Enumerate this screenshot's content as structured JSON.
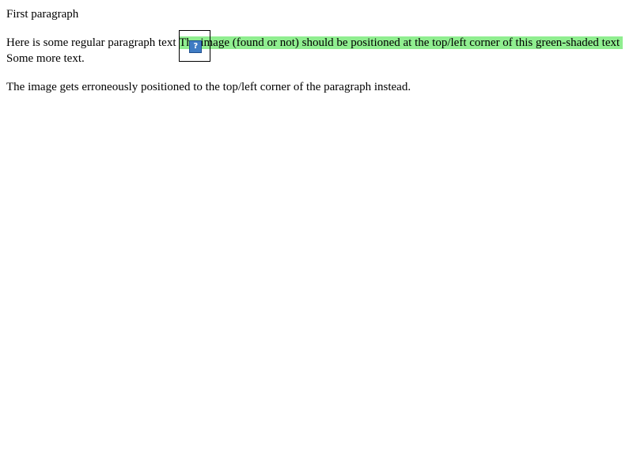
{
  "paragraphs": {
    "first": "First paragraph",
    "second_regular": "Here is some regular paragraph text ",
    "second_shaded": "The image (found or not) should be positioned at the top/left corner of this green-shaded text",
    "second_after": "Some more text.",
    "third": "The image gets erroneously positioned to the top/left corner of the paragraph instead."
  },
  "image": {
    "icon": "broken-image-icon",
    "glyph": "?"
  },
  "colors": {
    "shade": "#90ee90",
    "icon_fill": "#3f7cc4"
  }
}
